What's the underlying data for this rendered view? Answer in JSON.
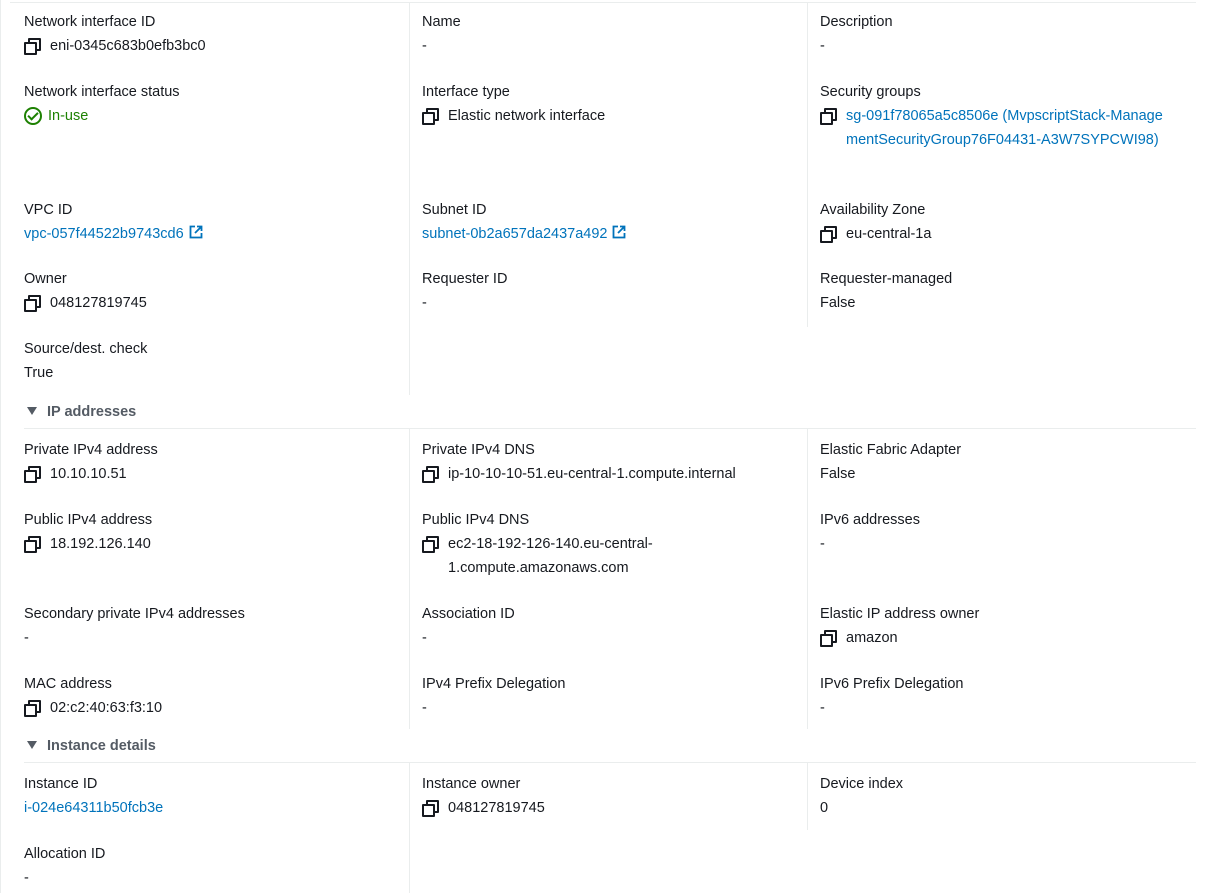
{
  "details": {
    "network_interface_id": {
      "label": "Network interface ID",
      "value": "eni-0345c683b0efb3bc0"
    },
    "name": {
      "label": "Name",
      "value": "-"
    },
    "description": {
      "label": "Description",
      "value": "-"
    },
    "status": {
      "label": "Network interface status",
      "value": "In-use"
    },
    "interface_type": {
      "label": "Interface type",
      "value": "Elastic network interface"
    },
    "security_groups": {
      "label": "Security groups",
      "value": "sg-091f78065a5c8506e (MvpscriptStack-ManagementSecurityGroup76F04431-A3W7SYPCWI98)"
    },
    "vpc_id": {
      "label": "VPC ID",
      "value": "vpc-057f44522b9743cd6"
    },
    "subnet_id": {
      "label": "Subnet ID",
      "value": "subnet-0b2a657da2437a492"
    },
    "availability_zone": {
      "label": "Availability Zone",
      "value": "eu-central-1a"
    },
    "owner": {
      "label": "Owner",
      "value": "048127819745"
    },
    "requester_id": {
      "label": "Requester ID",
      "value": "-"
    },
    "requester_managed": {
      "label": "Requester-managed",
      "value": "False"
    },
    "source_dest_check": {
      "label": "Source/dest. check",
      "value": "True"
    }
  },
  "ip_addresses": {
    "header": "IP addresses",
    "private_ipv4": {
      "label": "Private IPv4 address",
      "value": "10.10.10.51"
    },
    "private_ipv4_dns": {
      "label": "Private IPv4 DNS",
      "value": "ip-10-10-10-51.eu-central-1.compute.internal"
    },
    "elastic_fabric_adapter": {
      "label": "Elastic Fabric Adapter",
      "value": "False"
    },
    "public_ipv4": {
      "label": "Public IPv4 address",
      "value": "18.192.126.140"
    },
    "public_ipv4_dns": {
      "label": "Public IPv4 DNS",
      "value": "ec2-18-192-126-140.eu-central-1.compute.amazonaws.com"
    },
    "ipv6_addresses": {
      "label": "IPv6 addresses",
      "value": "-"
    },
    "secondary_private_ipv4": {
      "label": "Secondary private IPv4 addresses",
      "value": "-"
    },
    "association_id": {
      "label": "Association ID",
      "value": "-"
    },
    "elastic_ip_owner": {
      "label": "Elastic IP address owner",
      "value": "amazon"
    },
    "mac_address": {
      "label": "MAC address",
      "value": "02:c2:40:63:f3:10"
    },
    "ipv4_prefix_delegation": {
      "label": "IPv4 Prefix Delegation",
      "value": "-"
    },
    "ipv6_prefix_delegation": {
      "label": "IPv6 Prefix Delegation",
      "value": "-"
    }
  },
  "instance_details": {
    "header": "Instance details",
    "instance_id": {
      "label": "Instance ID",
      "value": "i-024e64311b50fcb3e"
    },
    "instance_owner": {
      "label": "Instance owner",
      "value": "048127819745"
    },
    "device_index": {
      "label": "Device index",
      "value": "0"
    },
    "allocation_id": {
      "label": "Allocation ID",
      "value": "-"
    }
  },
  "colors": {
    "link": "#0073bb",
    "success": "#1d8102",
    "text": "#16191f",
    "divider": "#eaeded",
    "muted": "#545b64"
  },
  "icons": [
    "copy-icon",
    "check-circle-icon",
    "external-link-icon",
    "caret-down-icon"
  ]
}
